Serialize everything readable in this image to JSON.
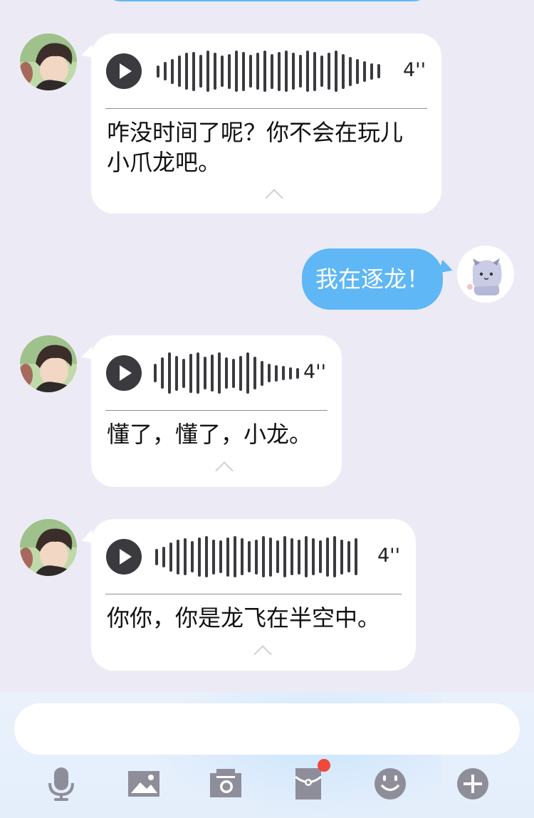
{
  "colors": {
    "background": "#ECEBF5",
    "sent_bubble": "#5FB7F5",
    "received_bubble": "#FFFFFF",
    "play_button": "#3A3A3F",
    "toolbar_icon": "#8E8E9A",
    "badge": "#F0483B"
  },
  "messages": [
    {
      "type": "voice",
      "direction": "received",
      "avatar": "contact-avatar",
      "duration": "4''",
      "transcript": "咋没时间了呢？你不会在玩儿\n小爪龙吧。",
      "waveform": [
        0.3,
        0.45,
        0.6,
        0.75,
        0.9,
        0.95,
        0.8,
        1.0,
        0.9,
        0.75,
        0.85,
        1.0,
        0.95,
        0.8,
        0.9,
        1.0,
        0.85,
        0.95,
        1.0,
        0.9,
        0.8,
        1.0,
        0.95,
        0.75,
        0.9,
        1.0,
        0.85,
        0.7,
        0.6,
        0.5,
        0.4,
        0.35
      ]
    },
    {
      "type": "text",
      "direction": "sent",
      "avatar": "self-cat-avatar",
      "text": "我在逐龙！"
    },
    {
      "type": "voice",
      "direction": "received",
      "avatar": "contact-avatar",
      "duration": "4''",
      "transcript": "懂了，懂了，小龙。",
      "waveform": [
        0.45,
        0.75,
        1.0,
        0.85,
        0.7,
        0.95,
        1.0,
        0.8,
        0.9,
        1.0,
        0.75,
        0.7,
        0.85,
        1.0,
        0.8,
        0.6,
        0.45,
        0.4,
        0.35,
        0.3,
        0.25
      ]
    },
    {
      "type": "voice",
      "direction": "received",
      "avatar": "contact-avatar",
      "duration": "4''",
      "transcript": "你你，你是龙飞在半空中。",
      "waveform": [
        0.4,
        0.5,
        0.7,
        0.85,
        0.9,
        0.75,
        0.95,
        1.0,
        0.85,
        0.8,
        0.95,
        1.0,
        0.9,
        0.75,
        0.85,
        1.0,
        0.95,
        0.8,
        1.0,
        0.9,
        0.85,
        1.0,
        0.9,
        0.8,
        0.95,
        1.0,
        0.85,
        0.75,
        0.9
      ]
    }
  ],
  "input": {
    "value": "",
    "placeholder": ""
  },
  "toolbar": [
    {
      "icon": "microphone-icon"
    },
    {
      "icon": "image-icon"
    },
    {
      "icon": "camera-icon"
    },
    {
      "icon": "red-packet-icon",
      "badge": true
    },
    {
      "icon": "emoji-icon"
    },
    {
      "icon": "plus-icon"
    }
  ]
}
